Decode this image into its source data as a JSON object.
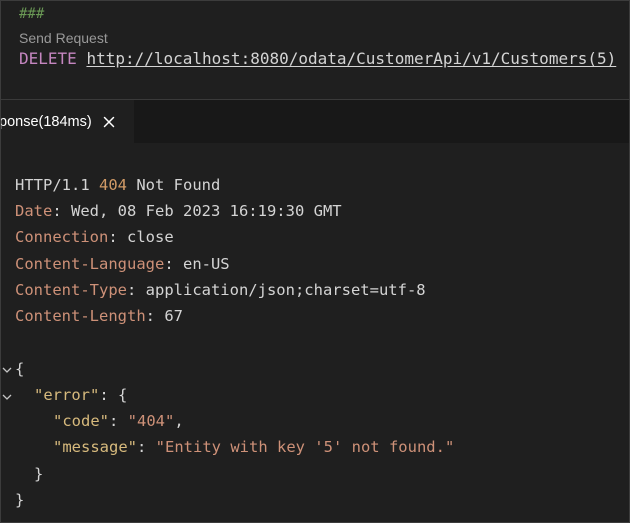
{
  "editor": {
    "separator_comment": "###",
    "codelens_label": "Send Request",
    "method": "DELETE",
    "url": "http://localhost:8080/odata/CustomerApi/v1/Customers(5)"
  },
  "response_tab": {
    "label": "ponse(184ms)",
    "close_icon": "close-icon"
  },
  "response": {
    "status_line": {
      "protocol": "HTTP/1.1",
      "code": "404",
      "text": "Not Found"
    },
    "headers": [
      {
        "name": "Date",
        "sep": ": ",
        "value": "Wed, 08 Feb 2023 16:19:30 GMT"
      },
      {
        "name": "Connection",
        "sep": ": ",
        "value": "close"
      },
      {
        "name": "Content-Language",
        "sep": ": ",
        "value": "en-US"
      },
      {
        "name": "Content-Type",
        "sep": ": ",
        "value": "application/json;charset=utf-8"
      },
      {
        "name": "Content-Length",
        "sep": ": ",
        "value": "67"
      }
    ],
    "body": {
      "open_brace": "{",
      "error_key": "\"error\"",
      "error_open": ": {",
      "code_key": "\"code\"",
      "code_sep": ": ",
      "code_value": "\"404\"",
      "code_comma": ",",
      "message_key": "\"message\"",
      "message_sep": ": ",
      "message_value": "\"Entity with key '5' not found.\"",
      "inner_close": "}",
      "outer_close": "}"
    }
  },
  "colors": {
    "background": "#1f1f1f",
    "header_name": "#ce9178",
    "status_code": "#d19a66",
    "json_key": "#d7ba7d",
    "json_string": "#ce9178",
    "method": "#c586c0",
    "comment": "#6a9955"
  }
}
